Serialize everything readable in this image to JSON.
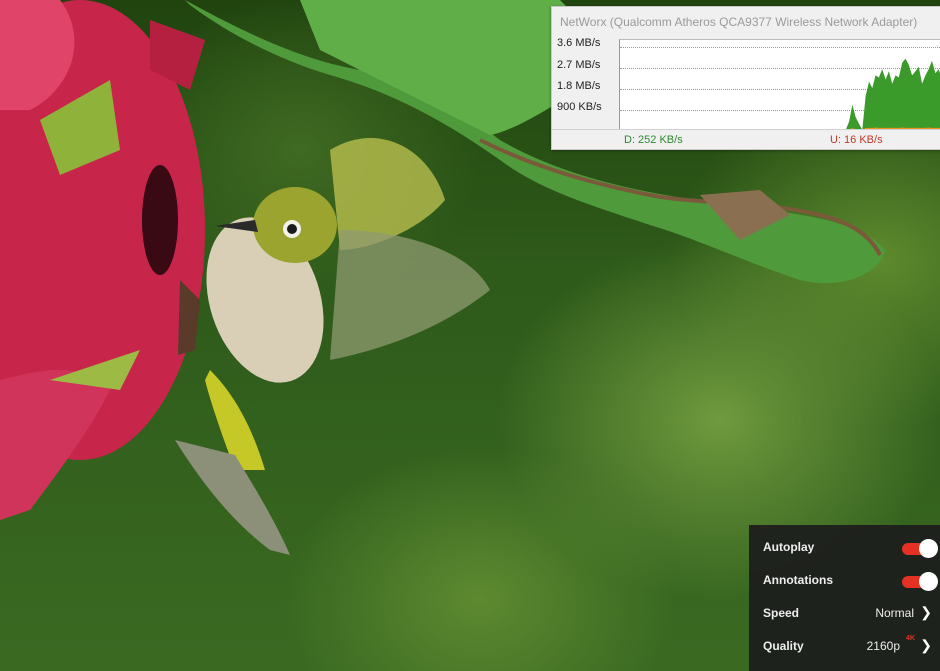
{
  "networx": {
    "title": "NetWorx (Qualcomm Atheros QCA9377 Wireless Network Adapter)",
    "y_labels": [
      "3.6 MB/s",
      "2.7 MB/s",
      "1.8 MB/s",
      "900 KB/s"
    ],
    "download": "D: 252 KB/s",
    "upload": "U: 16 KB/s",
    "colors": {
      "download": "#3a9a2a",
      "upload": "#e8961e"
    }
  },
  "chart_data": {
    "type": "area",
    "ylabels": [
      "3.6 MB/s",
      "2.7 MB/s",
      "1.8 MB/s",
      "900 KB/s"
    ],
    "ylim": [
      0,
      4.0
    ],
    "grid": true,
    "series": [
      {
        "name": "D",
        "values": [
          0,
          0,
          0,
          0,
          0,
          0,
          0,
          0,
          0,
          0,
          0,
          0,
          0,
          0,
          0,
          0,
          0,
          0,
          0,
          0,
          0,
          0,
          0,
          0,
          0,
          0,
          0,
          0,
          0,
          0,
          0,
          0,
          0,
          0,
          0,
          0,
          0,
          0,
          0,
          0,
          0,
          0,
          0,
          0,
          0,
          0,
          0,
          0,
          0,
          0,
          0,
          0,
          0,
          0,
          0,
          0,
          0,
          0,
          0,
          0,
          0,
          0,
          0,
          0,
          0,
          0,
          0,
          0,
          0,
          0.4,
          1.2,
          0.6,
          0.3,
          0,
          1.6,
          2.3,
          2.0,
          2.6,
          2.5,
          2.9,
          2.4,
          2.8,
          2.2,
          2.6,
          2.5,
          3.2,
          3.4,
          3.1,
          2.6,
          2.8,
          3.0,
          2.2,
          2.6,
          2.9,
          3.3,
          2.7,
          2.9,
          2.4
        ]
      },
      {
        "name": "U",
        "values": [
          0,
          0,
          0,
          0,
          0,
          0,
          0,
          0,
          0,
          0,
          0,
          0,
          0,
          0,
          0,
          0,
          0,
          0,
          0,
          0,
          0,
          0,
          0,
          0,
          0,
          0,
          0,
          0,
          0,
          0,
          0,
          0,
          0,
          0,
          0,
          0,
          0,
          0,
          0,
          0,
          0,
          0,
          0,
          0,
          0,
          0,
          0,
          0,
          0,
          0,
          0,
          0,
          0,
          0,
          0,
          0,
          0,
          0,
          0,
          0,
          0,
          0,
          0,
          0,
          0,
          0,
          0,
          0,
          0,
          0.05,
          0.08,
          0.05,
          0.04,
          0.03,
          0.09,
          0.1,
          0.1,
          0.12,
          0.1,
          0.1,
          0.1,
          0.11,
          0.1,
          0.1,
          0.1,
          0.12,
          0.1,
          0.1,
          0.1,
          0.11,
          0.1,
          0.1,
          0.1,
          0.12,
          0.1,
          0.1,
          0.1,
          0.1
        ]
      }
    ]
  },
  "menu": {
    "autoplay_label": "Autoplay",
    "annotations_label": "Annotations",
    "speed_label": "Speed",
    "speed_value": "Normal",
    "quality_label": "Quality",
    "quality_value": "2160p",
    "quality_badge": "4K",
    "autoplay_on": true,
    "annotations_on": true,
    "accent": "#e53124"
  }
}
